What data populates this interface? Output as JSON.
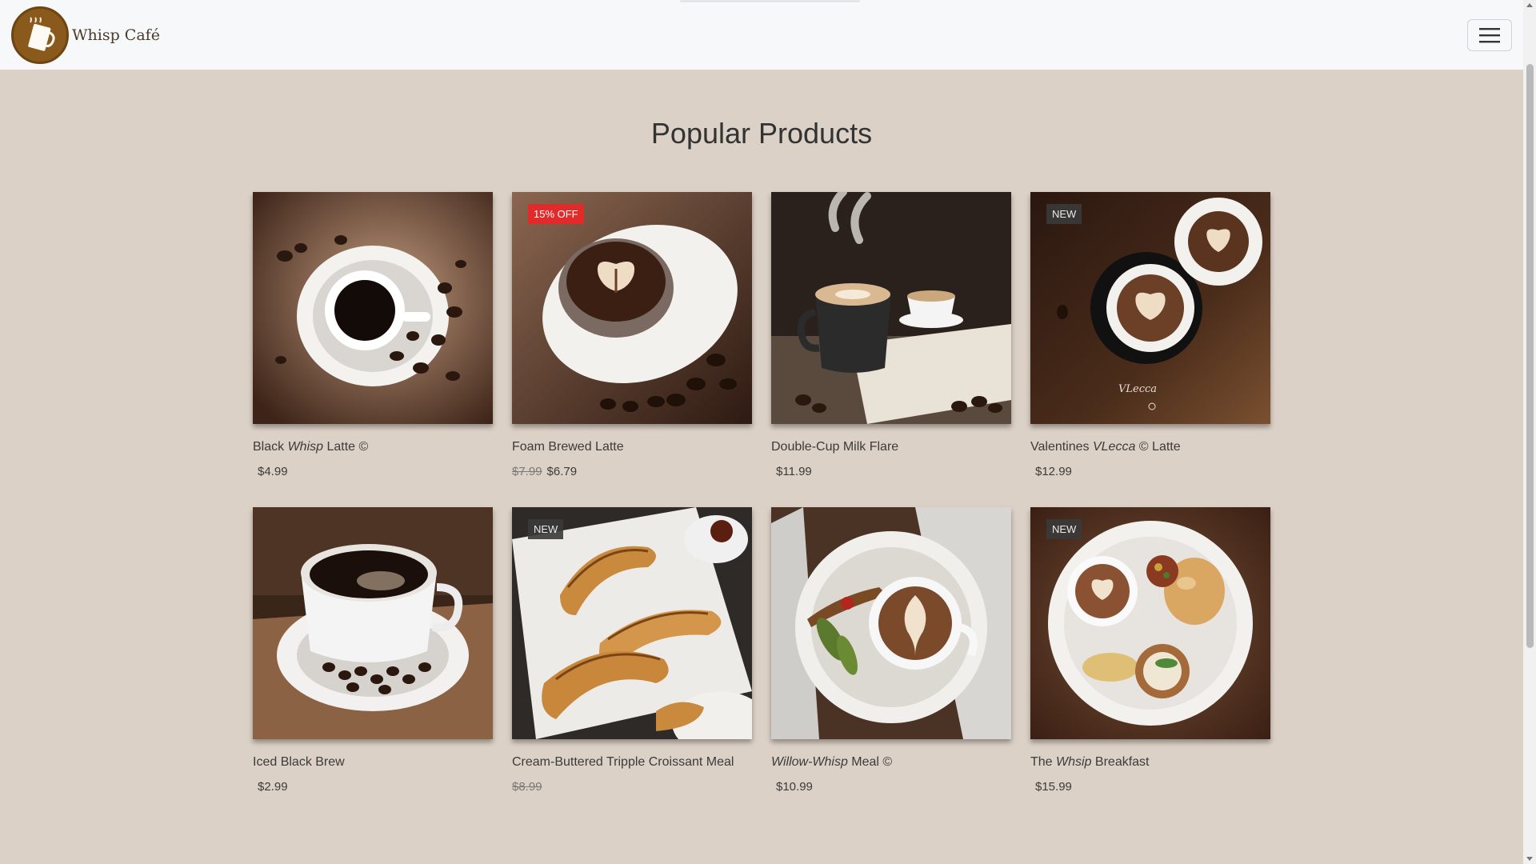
{
  "brand": {
    "name": "Whisp Café"
  },
  "main": {
    "title": "Popular Products"
  },
  "products": [
    {
      "name_parts": [
        "Black ",
        "Whisp",
        " Latte ©"
      ],
      "old_price": "",
      "price": "$4.99",
      "badge": "",
      "image": "black-coffee-cup-beans"
    },
    {
      "name_parts": [
        "Foam Brewed Latte",
        "",
        ""
      ],
      "old_price": "$7.99",
      "price": "$6.79",
      "badge": "15% OFF",
      "image": "latte-art-saucer"
    },
    {
      "name_parts": [
        "Double-Cup Milk Flare",
        "",
        ""
      ],
      "old_price": "",
      "price": "$11.99",
      "badge": "",
      "image": "steaming-cups-book"
    },
    {
      "name_parts": [
        "Valentines ",
        "VLecca",
        " © Latte"
      ],
      "old_price": "",
      "price": "$12.99",
      "badge": "NEW",
      "image": "heart-latte-cups"
    },
    {
      "name_parts": [
        "Iced Black Brew",
        "",
        ""
      ],
      "old_price": "",
      "price": "$2.99",
      "badge": "",
      "image": "coffee-cup-beans-napkin"
    },
    {
      "name_parts": [
        "Cream-Buttered Tripple Croissant Meal",
        "",
        ""
      ],
      "old_price": "$8.99",
      "price": "",
      "badge": "NEW",
      "image": "croissants-plate"
    },
    {
      "name_parts": [
        "",
        "Willow-Whisp",
        " Meal ©"
      ],
      "old_price": "",
      "price": "$10.99",
      "badge": "",
      "image": "latte-meal-plate"
    },
    {
      "name_parts": [
        "The ",
        "Whsip",
        " Breakfast"
      ],
      "old_price": "",
      "price": "$15.99",
      "badge": "NEW",
      "image": "breakfast-plate"
    }
  ],
  "colors": {
    "background": "#dcd1c6",
    "navbar": "#f7f8fa",
    "sale_badge": "#e22a2a",
    "new_badge": "#3a3a3a",
    "logo": "#8a5a1c"
  }
}
